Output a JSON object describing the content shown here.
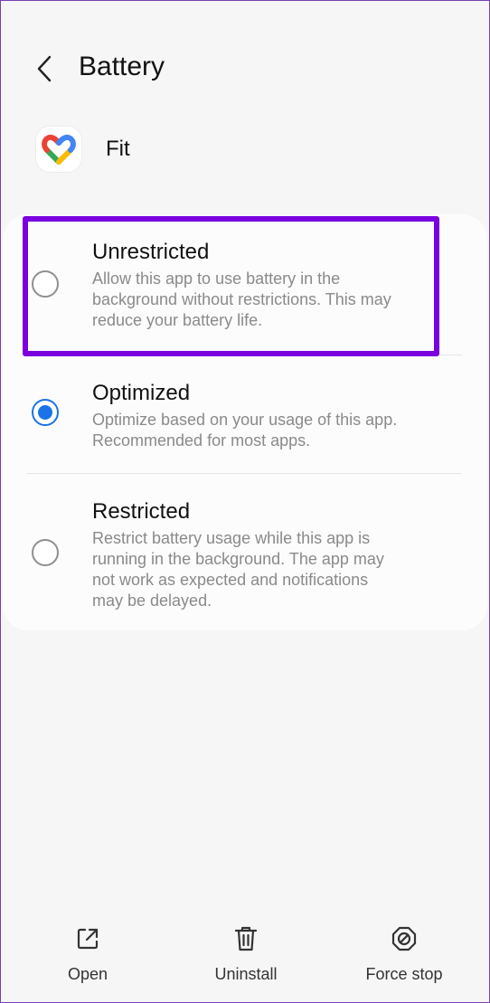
{
  "header": {
    "title": "Battery"
  },
  "app": {
    "name": "Fit"
  },
  "options": [
    {
      "title": "Unrestricted",
      "desc_lines": [
        "Allow this app to use battery in the",
        "background without restrictions. This may",
        "reduce your battery life."
      ],
      "selected": false
    },
    {
      "title": "Optimized",
      "desc_lines": [
        "Optimize based on your usage of this app.",
        "Recommended for most apps."
      ],
      "selected": true
    },
    {
      "title": "Restricted",
      "desc_lines": [
        "Restrict battery usage while this app is",
        "running in the background. The app may",
        "not work as expected and notifications",
        "may be delayed."
      ],
      "selected": false
    }
  ],
  "bottom_bar": {
    "open": "Open",
    "uninstall": "Uninstall",
    "force_stop": "Force stop"
  },
  "colors": {
    "accent": "#1a73e8",
    "highlight": "#7b00e0"
  }
}
